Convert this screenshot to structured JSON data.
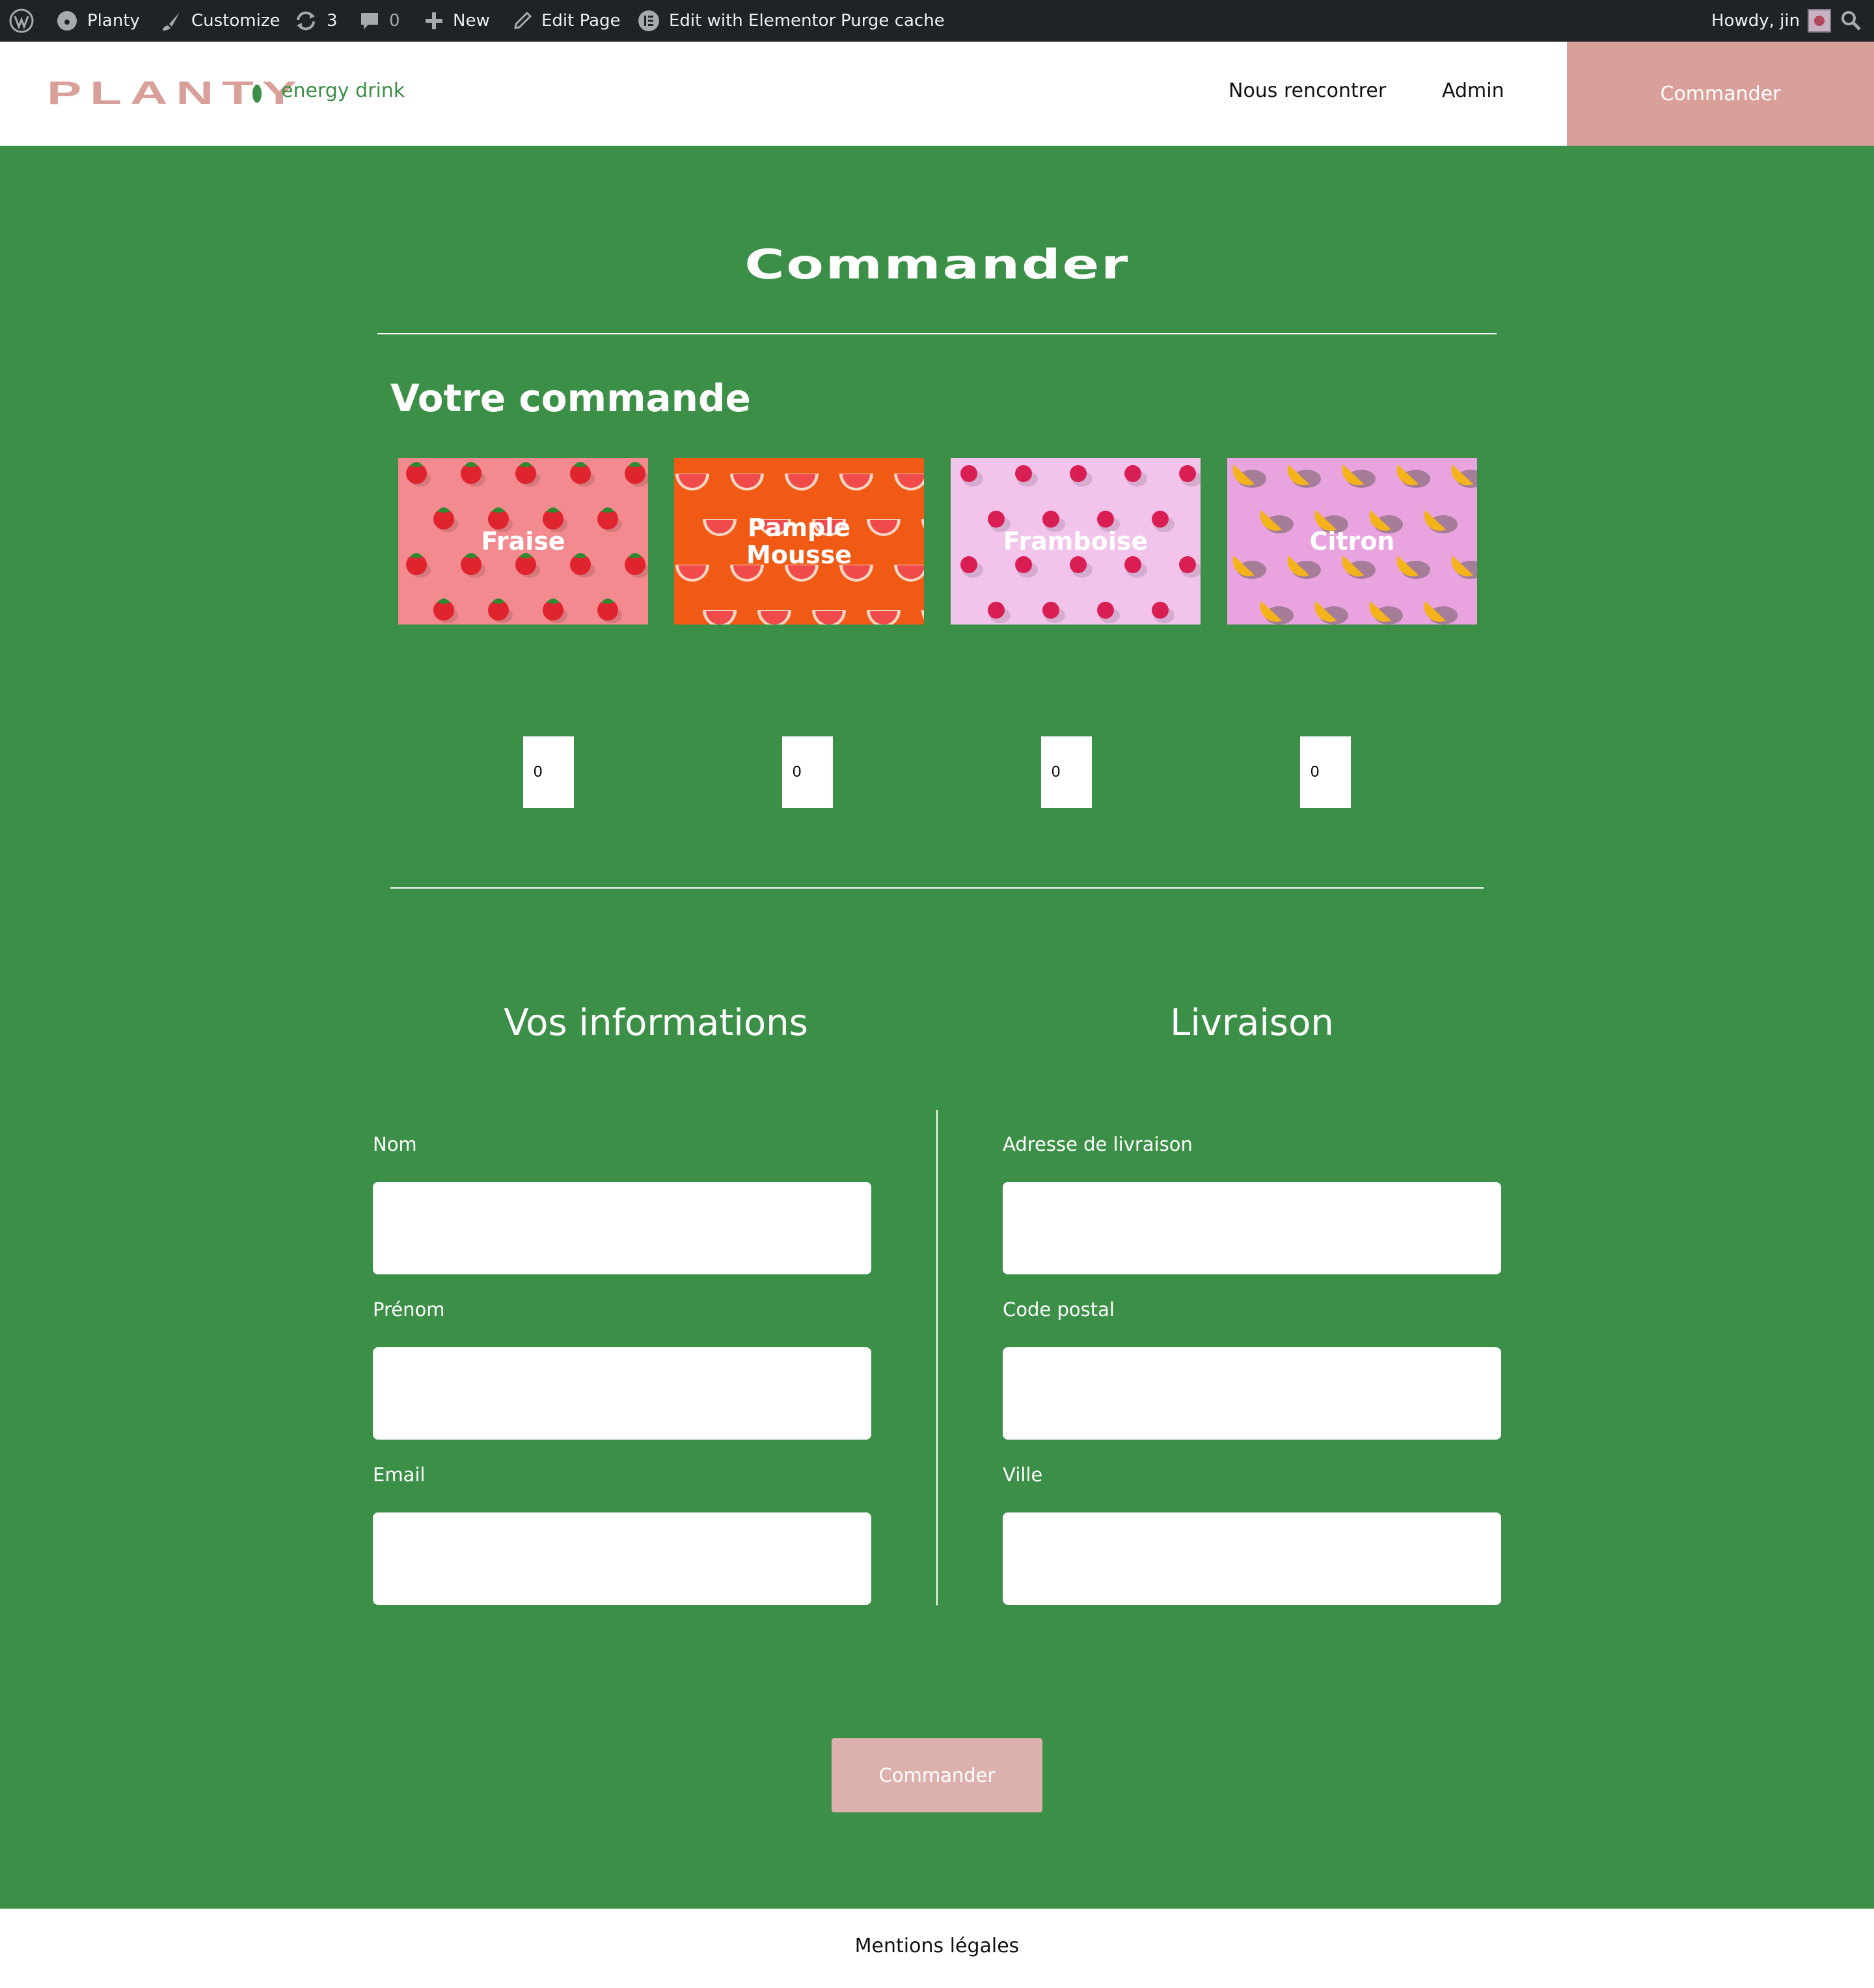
{
  "admin_bar": {
    "site_name": "Planty",
    "customize": "Customize",
    "updates_count": "3",
    "comments_count": "0",
    "new": "New",
    "edit_page": "Edit Page",
    "edit_elementor": "Edit with Elementor",
    "purge_cache": "Purge cache",
    "howdy": "Howdy, jin"
  },
  "header": {
    "logo": "PLANTY",
    "tagline": "energy drink",
    "nav": [
      "Nous rencontrer",
      "Admin"
    ],
    "cta": "Commander"
  },
  "main": {
    "title": "Commander",
    "order_heading": "Votre commande",
    "products": [
      {
        "name": "Fraise",
        "quantity": "0",
        "bg": "#f38a8f",
        "fruit_color": "#e0242e"
      },
      {
        "name": "Pample\nMousse",
        "quantity": "0",
        "bg": "#f05a14",
        "fruit_color": "#f04a4a"
      },
      {
        "name": "Framboise",
        "quantity": "0",
        "bg": "#f2c4ec",
        "fruit_color": "#d81e52"
      },
      {
        "name": "Citron",
        "quantity": "0",
        "bg": "#e9a4df",
        "fruit_color": "#f4b31a"
      }
    ]
  },
  "form": {
    "info_heading": "Vos informations",
    "delivery_heading": "Livraison",
    "info_fields": [
      "Nom",
      "Prénom",
      "Email"
    ],
    "delivery_fields": [
      "Adresse de livraison",
      "Code postal",
      "Ville"
    ],
    "submit": "Commander"
  },
  "footer": {
    "link": "Mentions légales"
  },
  "colors": {
    "green": "#3c8f47",
    "pink": "#d9a09a",
    "admin_bar": "#1d2327"
  }
}
